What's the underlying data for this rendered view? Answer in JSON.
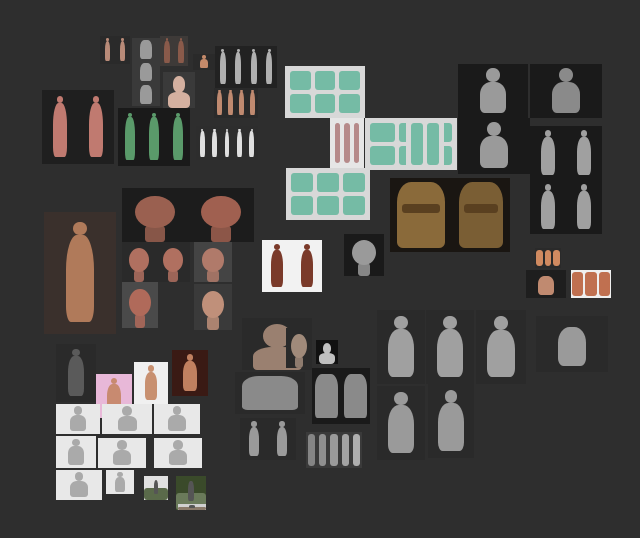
{
  "board": {
    "background": "#2e2e2e",
    "tiles": [
      {
        "name": "reference-tile-female-pair-small",
        "fig": "#b88a78",
        "bg": "#2a2a2a"
      },
      {
        "name": "reference-tile-torso-studies-gray",
        "fig": "#9a9a9a",
        "bg": "#3a3a3a"
      },
      {
        "name": "reference-tile-anatomy-pair",
        "fig": "#8a5a4a",
        "bg": "#3e3a38"
      },
      {
        "name": "reference-tile-small-torso",
        "fig": "#c48a6a",
        "bg": "#2a2a2a"
      },
      {
        "name": "reference-tile-gray-figures",
        "fig": "#b0b0b0",
        "bg": "#222222"
      },
      {
        "name": "reference-tile-bust-sculpt",
        "fig": "#d4b0a0",
        "bg": "#3a3a3a"
      },
      {
        "name": "reference-tile-skin-legs",
        "fig": "#c08a70",
        "bg": "#2a2a2a"
      },
      {
        "name": "reference-tile-white-figures-row",
        "fig": "#e0e0e0",
        "bg": "#2d2d2d"
      },
      {
        "name": "reference-tile-female-muscle-anatomy",
        "fig": "#c07a70",
        "bg": "#1f1f1f"
      },
      {
        "name": "reference-tile-colored-muscle-figures",
        "fig": "#5a9a6a",
        "bg": "#1a1a1a"
      },
      {
        "name": "reference-tile-nose-variations",
        "fig": "#6ab8a0",
        "bg": "#d8d8d8"
      },
      {
        "name": "reference-tile-lips-chart",
        "fig": "#b08080",
        "bg": "#e6e6e6"
      },
      {
        "name": "reference-tile-mouth-forms",
        "fig": "#6ab8a0",
        "bg": "#d8d8d8"
      },
      {
        "name": "reference-tile-ear-variations",
        "fig": "#6ab8a0",
        "bg": "#d8d8d8"
      },
      {
        "name": "reference-tile-skull-forms",
        "fig": "#6ab8a0",
        "bg": "#d8d8d8"
      },
      {
        "name": "reference-tile-armor-front",
        "fig": "#9a9a9a",
        "bg": "#1a1a1a"
      },
      {
        "name": "reference-tile-armor-back",
        "fig": "#8a8a8a",
        "bg": "#1a1a1a"
      },
      {
        "name": "reference-tile-armor-torso-alt",
        "fig": "#9a9a9a",
        "bg": "#1a1a1a"
      },
      {
        "name": "reference-tile-knight-turnaround",
        "fig": "#a0a0a0",
        "bg": "#1a1a1a"
      },
      {
        "name": "reference-tile-knight-turnaround-2",
        "fig": "#a0a0a0",
        "bg": "#1a1a1a"
      },
      {
        "name": "reference-tile-posing-female",
        "fig": "#b07a5a",
        "bg": "#3a302c"
      },
      {
        "name": "reference-tile-bald-head-sculpt",
        "fig": "#9a6050",
        "bg": "#1c1c1c"
      },
      {
        "name": "reference-tile-head-sculpt-2",
        "fig": "#a06050",
        "bg": "#1c1c1c"
      },
      {
        "name": "reference-tile-head-studies-pair",
        "fig": "#b07060",
        "bg": "#2a2a2a"
      },
      {
        "name": "reference-tile-head-profile",
        "fig": "#b07a6a",
        "bg": "#444444"
      },
      {
        "name": "reference-tile-head-anatomy",
        "fig": "#b06a5a",
        "bg": "#4a4a4a"
      },
      {
        "name": "reference-tile-ecorche-head",
        "fig": "#c0907a",
        "bg": "#3a3a3a"
      },
      {
        "name": "reference-tile-leather-jacket-back",
        "fig": "#8a6a3a",
        "bg": "#1a1612"
      },
      {
        "name": "reference-tile-leather-jacket-front",
        "fig": "#7a5e34",
        "bg": "#1a1612"
      },
      {
        "name": "reference-tile-character-concept",
        "fig": "#7a3a2a",
        "bg": "#f2f2f2"
      },
      {
        "name": "reference-tile-demon-head",
        "fig": "#9a9a9a",
        "bg": "#1a1a1a"
      },
      {
        "name": "reference-tile-face-thumbnails",
        "fig": "#d08a60",
        "bg": "#2a2a2a"
      },
      {
        "name": "reference-tile-hands-thumbnail",
        "fig": "#c08a70",
        "bg": "#1e1e1e"
      },
      {
        "name": "reference-tile-hand-anatomy",
        "fig": "#c07050",
        "bg": "#efefef"
      },
      {
        "name": "reference-tile-dark-hero",
        "fig": "#a0a0a0",
        "bg": "#2a2a2a"
      },
      {
        "name": "reference-tile-dark-hero-2",
        "fig": "#a0a0a0",
        "bg": "#2a2a2a"
      },
      {
        "name": "reference-tile-dark-hero-3",
        "fig": "#a0a0a0",
        "bg": "#2a2a2a"
      },
      {
        "name": "reference-tile-armored-hand",
        "fig": "#9a9a9a",
        "bg": "#2a2a2a"
      },
      {
        "name": "reference-tile-cloaked-figure",
        "fig": "#5a5a5a",
        "bg": "#2a2a2a"
      },
      {
        "name": "reference-tile-bodybuilder-pink",
        "fig": "#c88a70",
        "bg": "#e8b8d8"
      },
      {
        "name": "reference-tile-bodybuilder-blue",
        "fig": "#c89070",
        "bg": "#f0f0f0"
      },
      {
        "name": "reference-tile-bodybuilder-red",
        "fig": "#c08060",
        "bg": "#3a1a14"
      },
      {
        "name": "reference-tile-creature-bust",
        "fig": "#9a8070",
        "bg": "#2a2a2a"
      },
      {
        "name": "reference-tile-creature-bust-2",
        "fig": "#a08a7a",
        "bg": "#2a2a2a"
      },
      {
        "name": "reference-tile-small-dark-sculpt",
        "fig": "#c0c0c0",
        "bg": "#111111"
      },
      {
        "name": "reference-tile-armor-torso-gray",
        "fig": "#8a8a8a",
        "bg": "#2a2a2a"
      },
      {
        "name": "reference-tile-armor-pieces",
        "fig": "#8a8a8a",
        "bg": "#1a1a1a"
      },
      {
        "name": "reference-tile-armor-front-back",
        "fig": "#9a9a9a",
        "bg": "#2a2a2a"
      },
      {
        "name": "reference-tile-fabric-folds",
        "fig": "#b8b8b8",
        "bg": "#3a3a3a"
      },
      {
        "name": "reference-tile-soldier-gray-1",
        "fig": "#9a9a9a",
        "bg": "#2a2a2a"
      },
      {
        "name": "reference-tile-soldier-gray-2",
        "fig": "#9a9a9a",
        "bg": "#2a2a2a"
      },
      {
        "name": "reference-tile-martial-pose-1",
        "fig": "#aaaaaa",
        "bg": "#e8e8e8"
      },
      {
        "name": "reference-tile-martial-pose-2",
        "fig": "#aaaaaa",
        "bg": "#e8e8e8"
      },
      {
        "name": "reference-tile-martial-pose-3",
        "fig": "#aaaaaa",
        "bg": "#e8e8e8"
      },
      {
        "name": "reference-tile-martial-pose-4",
        "fig": "#aaaaaa",
        "bg": "#e8e8e8"
      },
      {
        "name": "reference-tile-martial-pose-5",
        "fig": "#aaaaaa",
        "bg": "#e8e8e8"
      },
      {
        "name": "reference-tile-martial-pose-6",
        "fig": "#aaaaaa",
        "bg": "#e8e8e8"
      },
      {
        "name": "reference-tile-martial-pose-7",
        "fig": "#aaaaaa",
        "bg": "#e8e8e8"
      },
      {
        "name": "reference-tile-martial-pose-8",
        "fig": "#aaaaaa",
        "bg": "#e8e8e8"
      },
      {
        "name": "reference-tile-outdoor-photo-1",
        "fig": "#5a6a4a",
        "bg": "#e0e0e0"
      },
      {
        "name": "reference-tile-outdoor-photo-2",
        "fig": "#6a7a5a",
        "bg": "#3a4a2a"
      },
      {
        "name": "reference-tile-outdoor-photo-3",
        "fig": "#8a7a6a",
        "bg": "#d0d0d0"
      }
    ]
  }
}
